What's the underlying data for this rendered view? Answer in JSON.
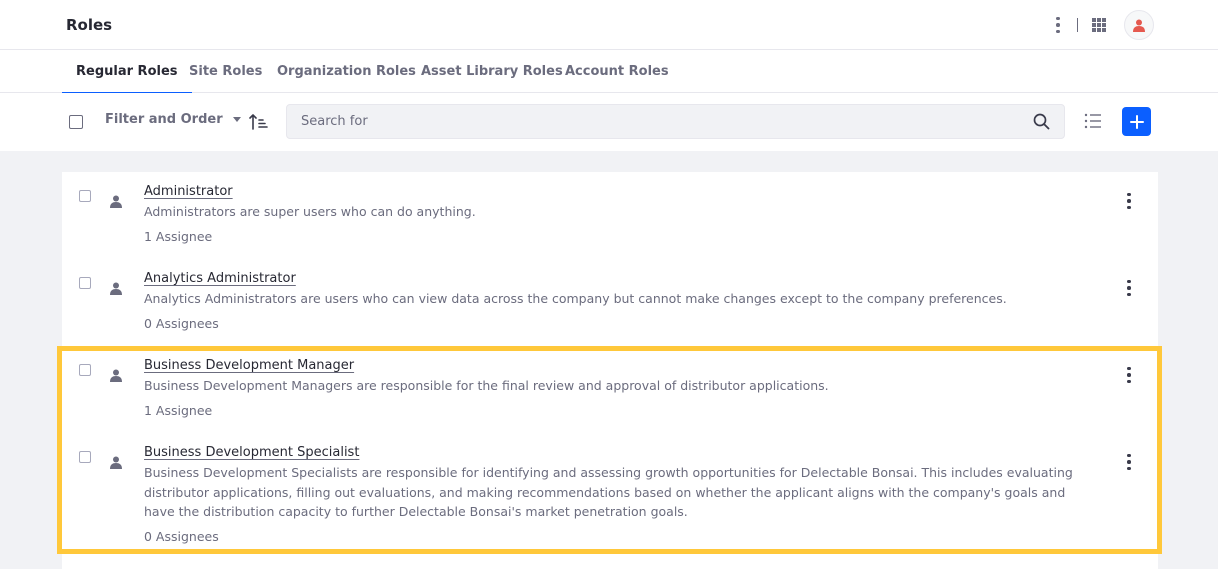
{
  "header": {
    "title": "Roles"
  },
  "tabs": [
    {
      "label": "Regular Roles",
      "active": true
    },
    {
      "label": "Site Roles",
      "active": false
    },
    {
      "label": "Organization Roles",
      "active": false
    },
    {
      "label": "Asset Library Roles",
      "active": false
    },
    {
      "label": "Account Roles",
      "active": false
    }
  ],
  "toolbar": {
    "filter_label": "Filter and Order",
    "search_placeholder": "Search for",
    "icons": [
      "sort-icon",
      "search-icon",
      "list-view-icon",
      "plus-icon"
    ]
  },
  "roles": [
    {
      "name": "Administrator",
      "description": "Administrators are super users who can do anything.",
      "assignees": "1 Assignee"
    },
    {
      "name": "Analytics Administrator",
      "description": "Analytics Administrators are users who can view data across the company but cannot make changes except to the company preferences.",
      "assignees": "0 Assignees"
    },
    {
      "name": "Business Development Manager",
      "description": "Business Development Managers are responsible for the final review and approval of distributor applications.",
      "assignees": "1 Assignee"
    },
    {
      "name": "Business Development Specialist",
      "description": "Business Development Specialists are responsible for identifying and assessing growth opportunities for Delectable Bonsai. This includes evaluating distributor applications, filling out evaluations, and making recommendations based on whether the applicant aligns with the company's goals and have the distribution capacity to further Delectable Bonsai's market penetration goals.",
      "assignees": "0 Assignees"
    }
  ],
  "colors": {
    "accent": "#0b5fff",
    "highlight": "#ffc83a",
    "avatar": "#e5594f"
  }
}
